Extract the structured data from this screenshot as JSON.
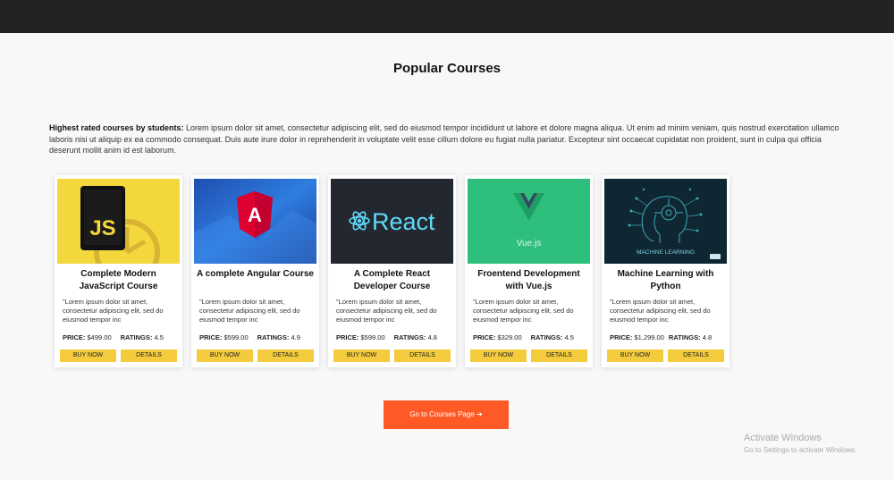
{
  "page": {
    "title": "Popular Courses",
    "intro_label": "Highest rated courses by students:",
    "intro_text": " Lorem ipsum dolor sit amet, consectetur adipiscing elit, sed do eiusmod tempor incididunt ut labore et dolore magna aliqua. Ut enim ad minim veniam, quis nostrud exercitation ullamco laboris nisi ut aliquip ex ea commodo consequat. Duis aute irure dolor in reprehenderit in voluptate velit esse cillum dolore eu fugiat nulla pariatur. Excepteur sint occaecat cupidatat non proident, sunt in culpa qui officia deserunt mollit anim id est laborum."
  },
  "labels": {
    "price": "PRICE:",
    "ratings": "RATINGS:",
    "buy": "BUY NOW",
    "details": "DETAILS"
  },
  "courses": [
    {
      "title": "Complete Modern JavaScript Course",
      "desc": "\"Lorem ipsum dolor sit amet, consectetur adipiscing elit, sed do eiusmod tempor inc",
      "price": "$499.00",
      "rating": "4.5",
      "image": "javascript-logo"
    },
    {
      "title": "A complete Angular Course",
      "desc": "\"Lorem ipsum dolor sit amet, consectetur adipiscing elit, sed do eiusmod tempor inc",
      "price": "$599.00",
      "rating": "4.9",
      "image": "angular-logo"
    },
    {
      "title": "A Complete React Developer Course",
      "desc": "\"Lorem ipsum dolor sit amet, consectetur adipiscing elit, sed do eiusmod tempor inc",
      "price": "$599.00",
      "rating": "4.8",
      "image": "react-logo",
      "image_text": "React"
    },
    {
      "title": "Froentend Development with Vue.js",
      "desc": "\"Lorem ipsum dolor sit amet, consectetur adipiscing elit, sed do eiusmod tempor inc",
      "price": "$329.00",
      "rating": "4.5",
      "image": "vue-logo",
      "image_text": "Vue.js"
    },
    {
      "title": "Machine Learning with Python",
      "desc": "\"Lorem ipsum dolor sit amet, consectetur adipiscing elit, sed do eiusmod tempor inc",
      "price": "$1,299.00",
      "rating": "4.8",
      "image": "machine-learning-illustration",
      "image_text": "MACHINE LEARNING"
    }
  ],
  "cta": {
    "label": "Go to Courses Page",
    "icon": "arrow-right-icon",
    "arrow": "➔"
  },
  "watermark": {
    "line1": "Activate Windows",
    "line2": "Go to Settings to activate Windows."
  },
  "colors": {
    "topbar": "#232323",
    "button_yellow": "#f3cb3c",
    "cta_orange": "#ff5a26"
  }
}
